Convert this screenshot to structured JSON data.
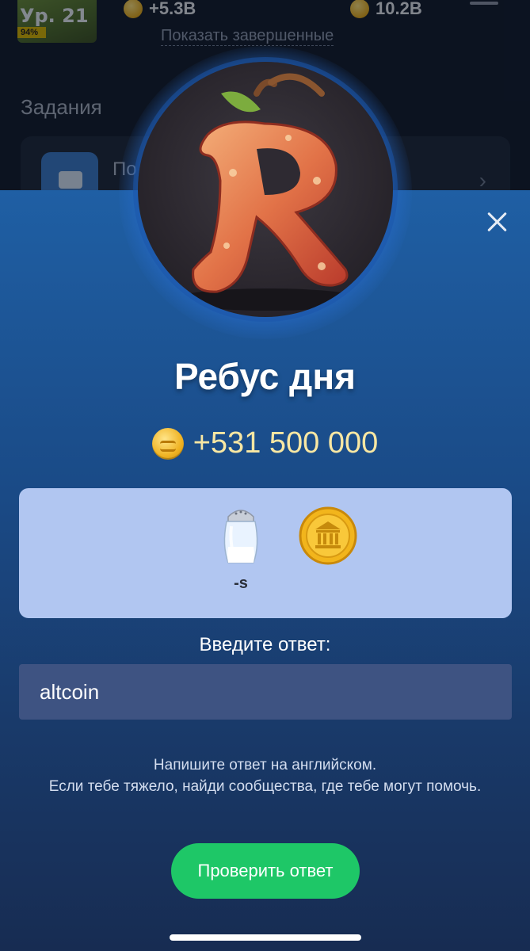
{
  "background": {
    "level_label": "Ур. 21",
    "level_percent": "94%",
    "stat_left": "+5.3B",
    "stat_right": "10.2B",
    "show_completed": "Показать завершенные",
    "tasks_title": "Задания",
    "task_label_partial": "По"
  },
  "modal": {
    "title": "Ребус дня",
    "reward": "+531 500 000",
    "rebus_caption": "-s",
    "prompt": "Введите ответ:",
    "answer_value": "altcoin",
    "hint_line1": "Напишите ответ на английском.",
    "hint_line2": "Если тебе тяжело, найди сообщества, где тебе могут помочь.",
    "check_button": "Проверить ответ"
  },
  "colors": {
    "accent_green": "#1ec767",
    "sheet_top": "#1f5fa4",
    "rebus_bg": "#b1c6f1",
    "reward_text": "#f8e7a3"
  },
  "icons": [
    "close-icon",
    "coin-icon",
    "salt-shaker-icon",
    "gold-coin-icon",
    "apple-r-logo"
  ]
}
